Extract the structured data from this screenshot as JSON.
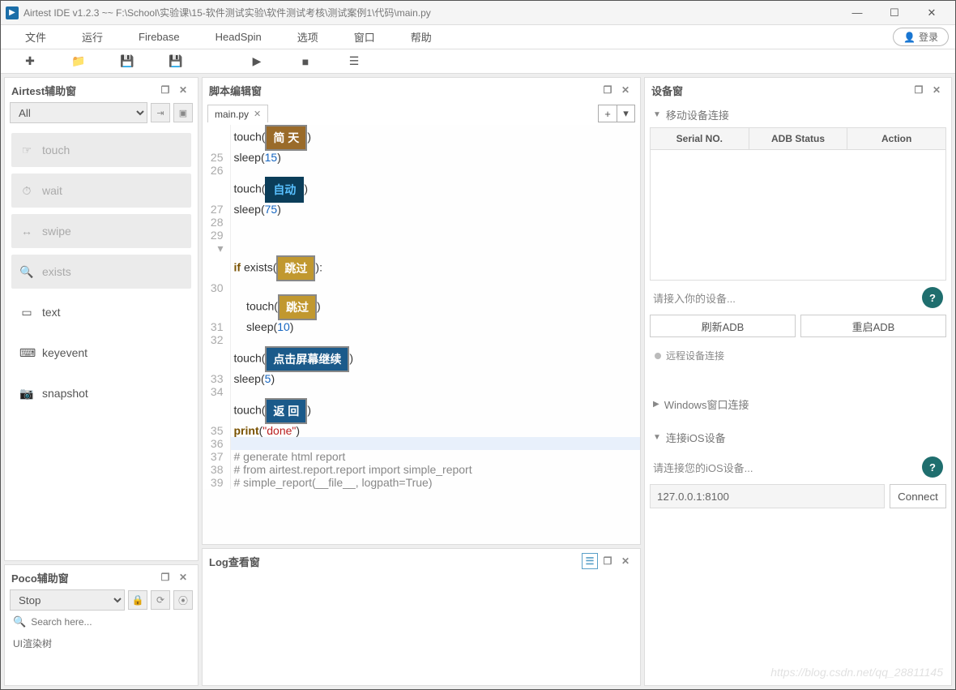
{
  "window": {
    "title": "Airtest IDE v1.2.3 ~~ F:\\School\\实验课\\15-软件测试实验\\软件测试考核\\测试案例1\\代码\\main.py"
  },
  "menu": {
    "items": [
      "文件",
      "运行",
      "Firebase",
      "HeadSpin",
      "选项",
      "窗口",
      "帮助"
    ],
    "login": "登录"
  },
  "left_panel": {
    "title": "Airtest辅助窗",
    "filter": "All",
    "tools": [
      {
        "icon": "☞",
        "label": "touch",
        "enabled": false
      },
      {
        "icon": "⏱",
        "label": "wait",
        "enabled": false
      },
      {
        "icon": "↔",
        "label": "swipe",
        "enabled": false
      },
      {
        "icon": "🔍",
        "label": "exists",
        "enabled": false
      },
      {
        "icon": "▭",
        "label": "text",
        "enabled": true
      },
      {
        "icon": "⌨",
        "label": "keyevent",
        "enabled": true
      },
      {
        "icon": "📷",
        "label": "snapshot",
        "enabled": true
      }
    ]
  },
  "poco_panel": {
    "title": "Poco辅助窗",
    "mode": "Stop",
    "search_placeholder": "Search here...",
    "tree_label": "UI渲染树"
  },
  "editor": {
    "title": "脚本编辑窗",
    "tab": "main.py",
    "lines": [
      {
        "n": "",
        "kind": "touch_img",
        "img": "简 天",
        "cls": "brown"
      },
      {
        "n": "25",
        "kind": "sleep",
        "arg": "15"
      },
      {
        "n": "26",
        "kind": "blank"
      },
      {
        "n": "",
        "kind": "touch_img",
        "img": "自动",
        "cls": "darkblue"
      },
      {
        "n": "27",
        "kind": "sleep",
        "arg": "75"
      },
      {
        "n": "28",
        "kind": "blank"
      },
      {
        "n": "29 ▾",
        "kind": "blank"
      },
      {
        "n": "",
        "kind": "if_exists",
        "img": "跳过",
        "cls": "tan"
      },
      {
        "n": "30",
        "kind": "blank"
      },
      {
        "n": "",
        "kind": "touch_img_indent",
        "img": "跳过",
        "cls": "tan"
      },
      {
        "n": "31",
        "kind": "sleep_indent",
        "arg": "10"
      },
      {
        "n": "32",
        "kind": "blank"
      },
      {
        "n": "",
        "kind": "touch_img",
        "img": "点击屏幕继续",
        "cls": "blue"
      },
      {
        "n": "33",
        "kind": "sleep",
        "arg": "5"
      },
      {
        "n": "34",
        "kind": "blank"
      },
      {
        "n": "",
        "kind": "touch_img",
        "img": "返 回",
        "cls": "blue"
      },
      {
        "n": "35",
        "kind": "print",
        "arg": "\"done\""
      },
      {
        "n": "36",
        "kind": "blank",
        "hl": true
      },
      {
        "n": "37",
        "kind": "cmt",
        "text": "# generate html report"
      },
      {
        "n": "38",
        "kind": "cmt",
        "text": "# from airtest.report.report import simple_report"
      },
      {
        "n": "39",
        "kind": "cmt",
        "text": "# simple_report(__file__, logpath=True)"
      }
    ]
  },
  "log_panel": {
    "title": "Log查看窗"
  },
  "device_panel": {
    "title": "设备窗",
    "sec_mobile": "移动设备连接",
    "table_headers": [
      "Serial NO.",
      "ADB Status",
      "Action"
    ],
    "hint_mobile": "请接入你的设备...",
    "btn_refresh": "刷新ADB",
    "btn_restart": "重启ADB",
    "remote_status": "远程设备连接",
    "sec_windows": "Windows窗口连接",
    "sec_ios": "连接iOS设备",
    "hint_ios": "请连接您的iOS设备...",
    "ios_addr": "127.0.0.1:8100",
    "btn_connect": "Connect"
  },
  "watermark": "https://blog.csdn.net/qq_28811145"
}
